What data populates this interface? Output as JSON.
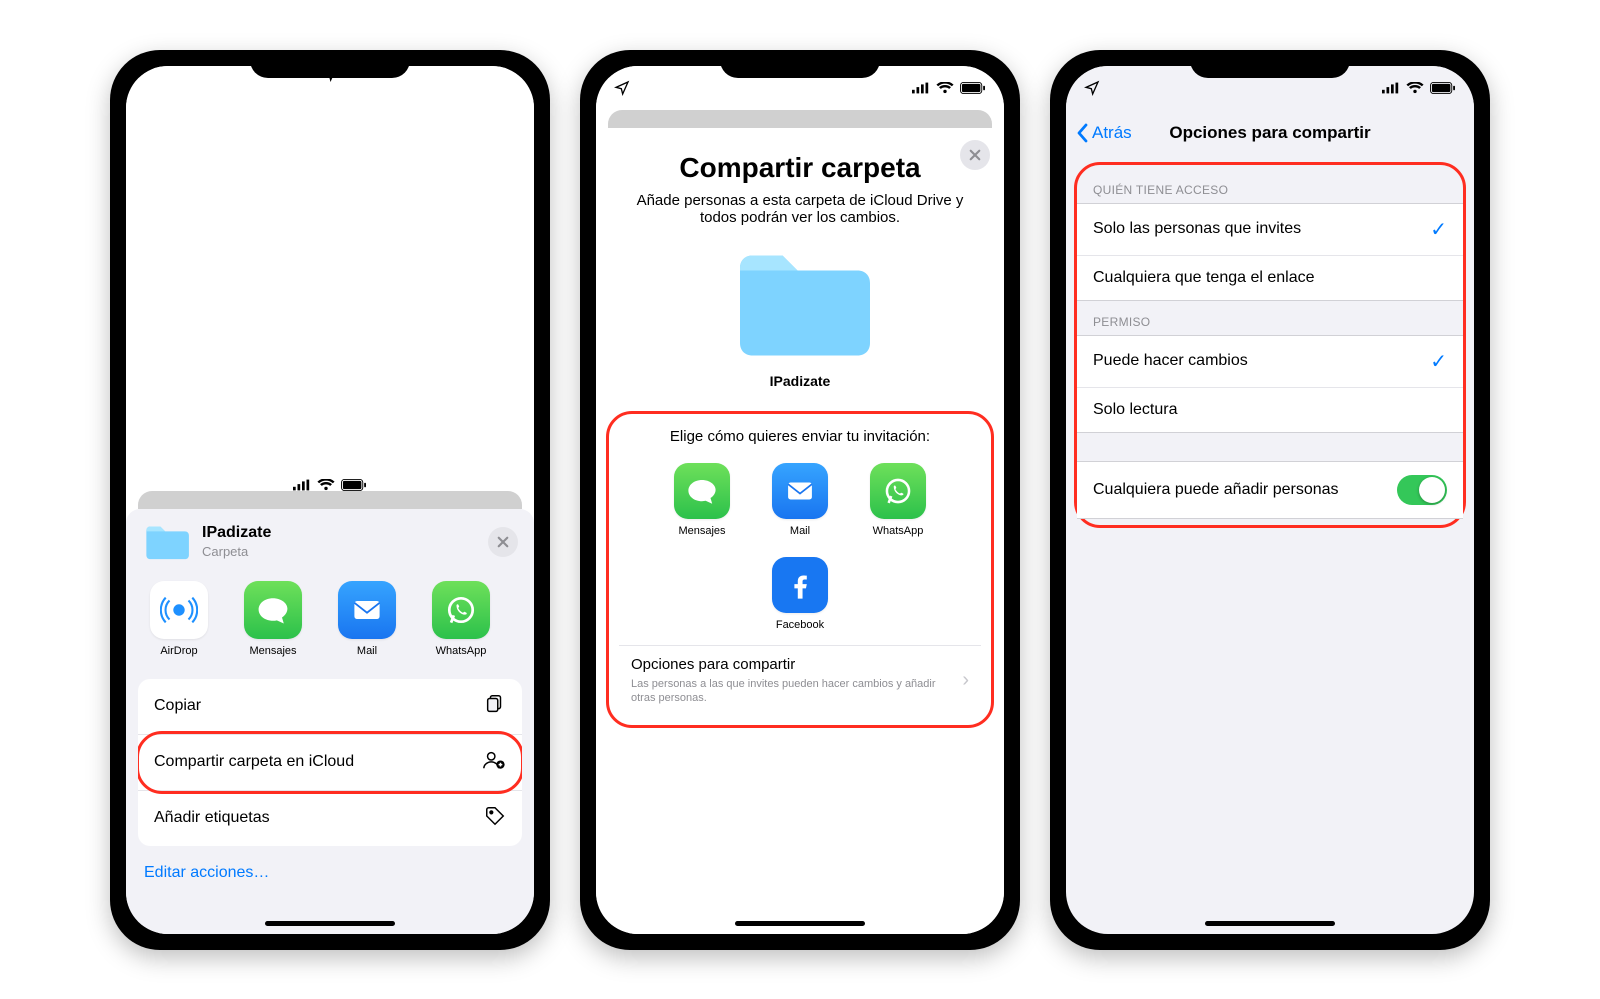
{
  "status": {
    "loc_icon": "location",
    "signal": "signal-4",
    "wifi": "wifi-3",
    "battery": "100"
  },
  "phone1": {
    "header": {
      "title": "IPadizate",
      "subtitle": "Carpeta",
      "close": "×"
    },
    "share_apps": [
      {
        "name": "AirDrop",
        "icon": "airdrop"
      },
      {
        "name": "Mensajes",
        "icon": "messages"
      },
      {
        "name": "Mail",
        "icon": "mail"
      },
      {
        "name": "WhatsApp",
        "icon": "whatsapp"
      }
    ],
    "actions": {
      "copy": "Copiar",
      "share_folder": "Compartir carpeta en iCloud",
      "add_tags": "Añadir etiquetas"
    },
    "edit_actions": "Editar acciones…"
  },
  "phone2": {
    "title": "Compartir carpeta",
    "subtitle": "Añade personas a esta carpeta de iCloud Drive y todos podrán ver los cambios.",
    "folder_name": "IPadizate",
    "invite_label": "Elige cómo quieres enviar tu invitación:",
    "invite_apps": [
      {
        "name": "Mensajes",
        "icon": "messages"
      },
      {
        "name": "Mail",
        "icon": "mail"
      },
      {
        "name": "WhatsApp",
        "icon": "whatsapp"
      },
      {
        "name": "Facebook",
        "icon": "facebook"
      }
    ],
    "options": {
      "title": "Opciones para compartir",
      "desc": "Las personas a las que invites pueden hacer cambios y añadir otras personas."
    }
  },
  "phone3": {
    "back": "Atrás",
    "title": "Opciones para compartir",
    "sections": {
      "access_header": "QUIÉN TIENE ACCESO",
      "access": {
        "invited": "Solo las personas que invites",
        "anyone_link": "Cualquiera que tenga el enlace"
      },
      "permission_header": "PERMISO",
      "permission": {
        "can_edit": "Puede hacer cambios",
        "read_only": "Solo lectura"
      },
      "anyone_can_add": "Cualquiera puede añadir personas",
      "access_selected": "invited",
      "permission_selected": "can_edit",
      "toggle_on": true
    }
  }
}
